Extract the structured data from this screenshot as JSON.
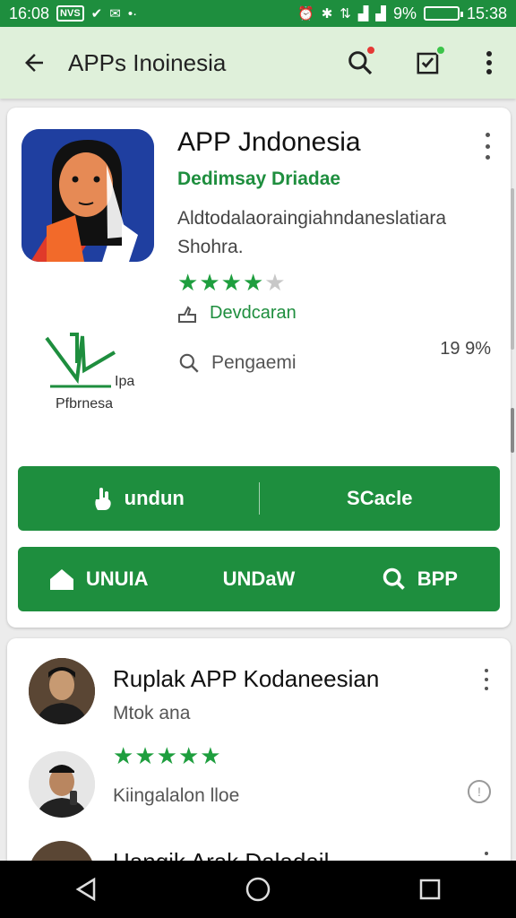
{
  "status_bar": {
    "time_left": "16:08",
    "badge1": "NVS",
    "percent": "9%",
    "time_right": "15:38"
  },
  "app_bar": {
    "title": "APPs Inoinesia"
  },
  "app_detail": {
    "title": "APP Jndonesia",
    "developer": "Dedimsay  Driadae",
    "description_line1": "Aldtodalaoraingiahndaneslatiara",
    "description_line2": "Shohra.",
    "rating_stars": 4,
    "rating_max": 5,
    "download_label": "Devdcaran",
    "search_label": "Pengaemi",
    "percent": "19 9%",
    "logo_text_top": "Ipa",
    "logo_text_bottom": "Pfbrnesa"
  },
  "buttons": {
    "undun": "undun",
    "scacle": "SCacle",
    "unuia": "UNUIA",
    "undaw": "UNDaW",
    "bpp": "BPP"
  },
  "reviews": [
    {
      "name": "Ruplak APP Kodaneesian",
      "subtitle": "Mtok ana"
    },
    {
      "stars": 5,
      "subtitle": "Kiingalalon lloe"
    },
    {
      "name": "Uangik Arak Daladail"
    }
  ],
  "colors": {
    "primary_green": "#1e8e3e",
    "app_bar_bg": "#dff0da",
    "badge_red": "#e53935",
    "badge_green": "#3cc44a"
  }
}
